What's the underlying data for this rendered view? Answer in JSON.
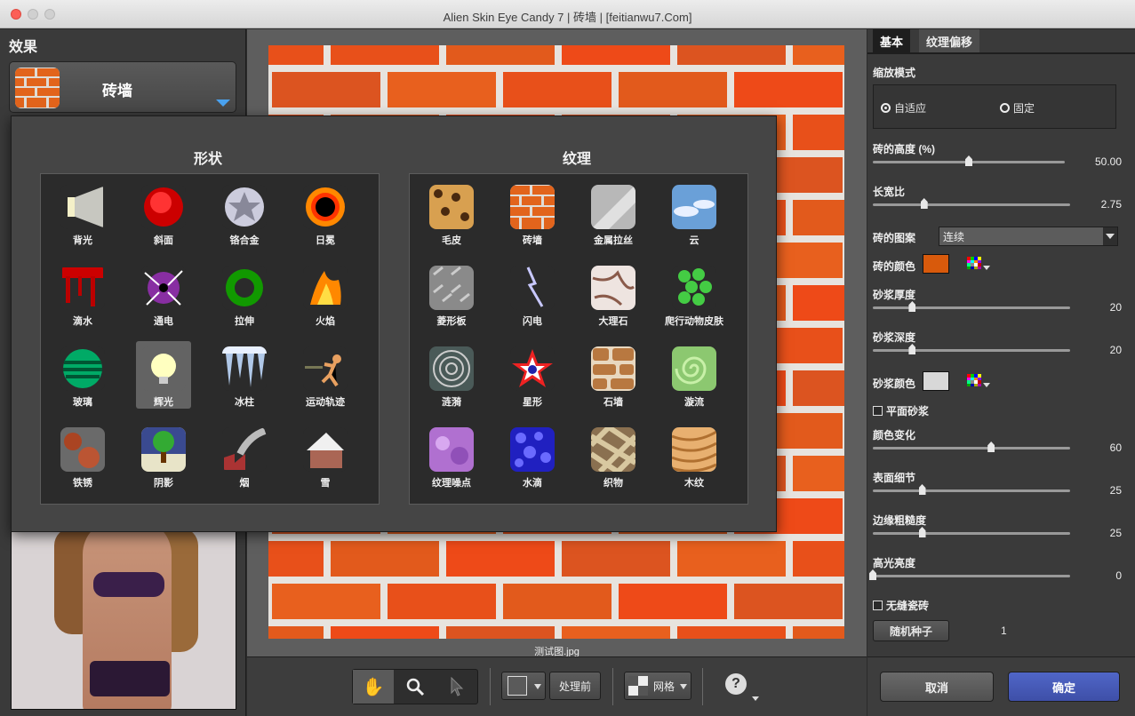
{
  "window": {
    "title": "Alien Skin Eye Candy 7 | 砖墙 | [feitianwu7.Com]"
  },
  "left_panel": {
    "title": "效果",
    "selected_effect": "砖墙"
  },
  "popup": {
    "shapes_title": "形状",
    "textures_title": "纹理",
    "shapes": [
      {
        "label": "背光",
        "icon": "backlight-icon"
      },
      {
        "label": "斜面",
        "icon": "bevel-icon"
      },
      {
        "label": "铬合金",
        "icon": "chrome-icon"
      },
      {
        "label": "日冕",
        "icon": "corona-icon"
      },
      {
        "label": "滴水",
        "icon": "drip-icon"
      },
      {
        "label": "通电",
        "icon": "electrify-icon"
      },
      {
        "label": "拉伸",
        "icon": "extrude-icon"
      },
      {
        "label": "火焰",
        "icon": "fire-icon"
      },
      {
        "label": "玻璃",
        "icon": "glass-icon"
      },
      {
        "label": "辉光",
        "icon": "glow-icon"
      },
      {
        "label": "冰柱",
        "icon": "icicles-icon"
      },
      {
        "label": "运动轨迹",
        "icon": "motion-trail-icon"
      },
      {
        "label": "铁锈",
        "icon": "rust-icon"
      },
      {
        "label": "阴影",
        "icon": "shadow-icon"
      },
      {
        "label": "烟",
        "icon": "smoke-icon"
      },
      {
        "label": "雪",
        "icon": "snow-icon"
      }
    ],
    "textures": [
      {
        "label": "毛皮",
        "icon": "fur-icon"
      },
      {
        "label": "砖墙",
        "icon": "brick-wall-icon"
      },
      {
        "label": "金属拉丝",
        "icon": "brushed-metal-icon"
      },
      {
        "label": "云",
        "icon": "clouds-icon"
      },
      {
        "label": "菱形板",
        "icon": "diamond-plate-icon"
      },
      {
        "label": "闪电",
        "icon": "lightning-icon"
      },
      {
        "label": "大理石",
        "icon": "marble-icon"
      },
      {
        "label": "爬行动物皮肤",
        "icon": "reptile-skin-icon"
      },
      {
        "label": "涟漪",
        "icon": "ripples-icon"
      },
      {
        "label": "星形",
        "icon": "star-icon"
      },
      {
        "label": "石墙",
        "icon": "stone-wall-icon"
      },
      {
        "label": "漩流",
        "icon": "swirl-icon"
      },
      {
        "label": "纹理噪点",
        "icon": "texture-noise-icon"
      },
      {
        "label": "水滴",
        "icon": "water-drops-icon"
      },
      {
        "label": "织物",
        "icon": "weave-icon"
      },
      {
        "label": "木纹",
        "icon": "wood-icon"
      }
    ]
  },
  "canvas": {
    "filename": "测试图.jpg"
  },
  "toolbar": {
    "before_label": "处理前",
    "grid_label": "网格",
    "help_label": "?"
  },
  "right_panel": {
    "tabs": [
      "基本",
      "纹理偏移"
    ],
    "scale_mode_label": "缩放模式",
    "scale_mode_options": [
      "自适应",
      "固定"
    ],
    "brick_height": {
      "label": "砖的高度 (%)",
      "value": "50.00",
      "fraction": 0.5
    },
    "aspect_ratio": {
      "label": "长宽比",
      "value": "2.75",
      "fraction": 0.26
    },
    "brick_pattern": {
      "label": "砖的图案",
      "value": "连续"
    },
    "brick_color": {
      "label": "砖的颜色",
      "color": "#d85a0c"
    },
    "mortar_thickness": {
      "label": "砂浆厚度",
      "value": "20",
      "fraction": 0.2
    },
    "mortar_depth": {
      "label": "砂浆深度",
      "value": "20",
      "fraction": 0.2
    },
    "mortar_color": {
      "label": "砂浆颜色",
      "color": "#d8d8d8"
    },
    "flat_mortar": {
      "label": "平面砂浆"
    },
    "color_variation": {
      "label": "颜色变化",
      "value": "60",
      "fraction": 0.6
    },
    "surface_detail": {
      "label": "表面细节",
      "value": "25",
      "fraction": 0.25
    },
    "edge_roughness": {
      "label": "边缘粗糙度",
      "value": "25",
      "fraction": 0.25
    },
    "highlight_brightness": {
      "label": "高光亮度",
      "value": "0",
      "fraction": 0.0
    },
    "seamless_tile": {
      "label": "无缝瓷砖"
    },
    "random_seed": {
      "label": "随机种子",
      "value": "1"
    },
    "cancel_label": "取消",
    "ok_label": "确定"
  }
}
